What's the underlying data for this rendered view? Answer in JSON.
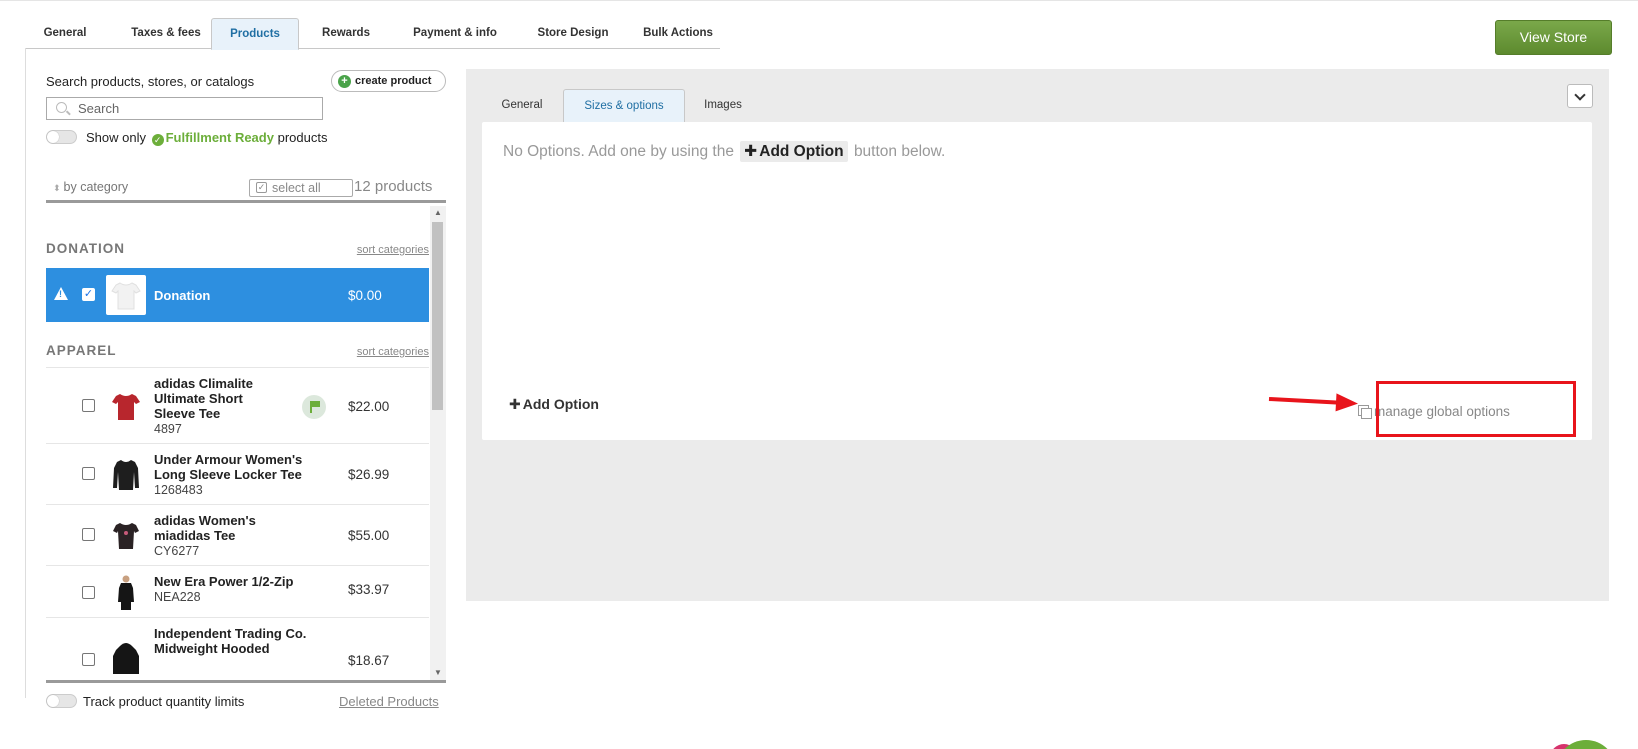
{
  "top_tabs": [
    {
      "label": "General"
    },
    {
      "label": "Taxes & fees"
    },
    {
      "label": "Products"
    },
    {
      "label": "Rewards"
    },
    {
      "label": "Payment & info"
    },
    {
      "label": "Store Design"
    },
    {
      "label": "Bulk Actions"
    }
  ],
  "active_top_tab": "Products",
  "view_store_label": "View Store",
  "left": {
    "search_label": "Search products, stores, or catalogs",
    "create_product_label": "create product",
    "search_placeholder": "Search",
    "show_only_prefix": "Show only",
    "fulfillment_ready": "Fulfillment Ready",
    "show_only_suffix": "products",
    "sort_by_label": "by category",
    "select_all_label": "select all",
    "product_count": "12 products",
    "sort_categories_label": "sort categories",
    "categories": [
      {
        "name": "DONATION"
      },
      {
        "name": "APPAREL"
      }
    ],
    "donation_item": {
      "name": "Donation",
      "price": "$0.00"
    },
    "apparel_items": [
      {
        "name": "adidas Climalite Ultimate Short Sleeve Tee",
        "sku": "4897",
        "price": "$22.00",
        "color": "#b8262d"
      },
      {
        "name": "Under Armour Women's Long Sleeve Locker Tee",
        "sku": "1268483",
        "price": "$26.99",
        "color": "#1e1e1e"
      },
      {
        "name": "adidas Women's miadidas Tee",
        "sku": "CY6277",
        "price": "$55.00",
        "color": "#2a2224"
      },
      {
        "name": "New Era Power 1/2-Zip",
        "sku": "NEA228",
        "price": "$33.97",
        "color": "#151515"
      },
      {
        "name": "Independent Trading Co. Midweight Hooded",
        "sku": "",
        "price": "$18.67",
        "color": "#151515"
      }
    ],
    "track_limits_label": "Track product quantity limits",
    "deleted_products_label": "Deleted Products"
  },
  "right": {
    "sub_tabs": [
      {
        "label": "General"
      },
      {
        "label": "Sizes & options"
      },
      {
        "label": "Images"
      }
    ],
    "active_sub_tab": "Sizes & options",
    "no_options_prefix": "No Options. Add one by using the",
    "inline_add_option": "Add Option",
    "no_options_suffix": "button below.",
    "add_option_label": "Add Option",
    "manage_global_label": "manage global options"
  },
  "colors": {
    "accent_blue": "#2d8fe0",
    "fulfillment_green": "#6cae3a",
    "view_store_green": "#6a9a3a",
    "highlight_red": "#e8141b"
  }
}
